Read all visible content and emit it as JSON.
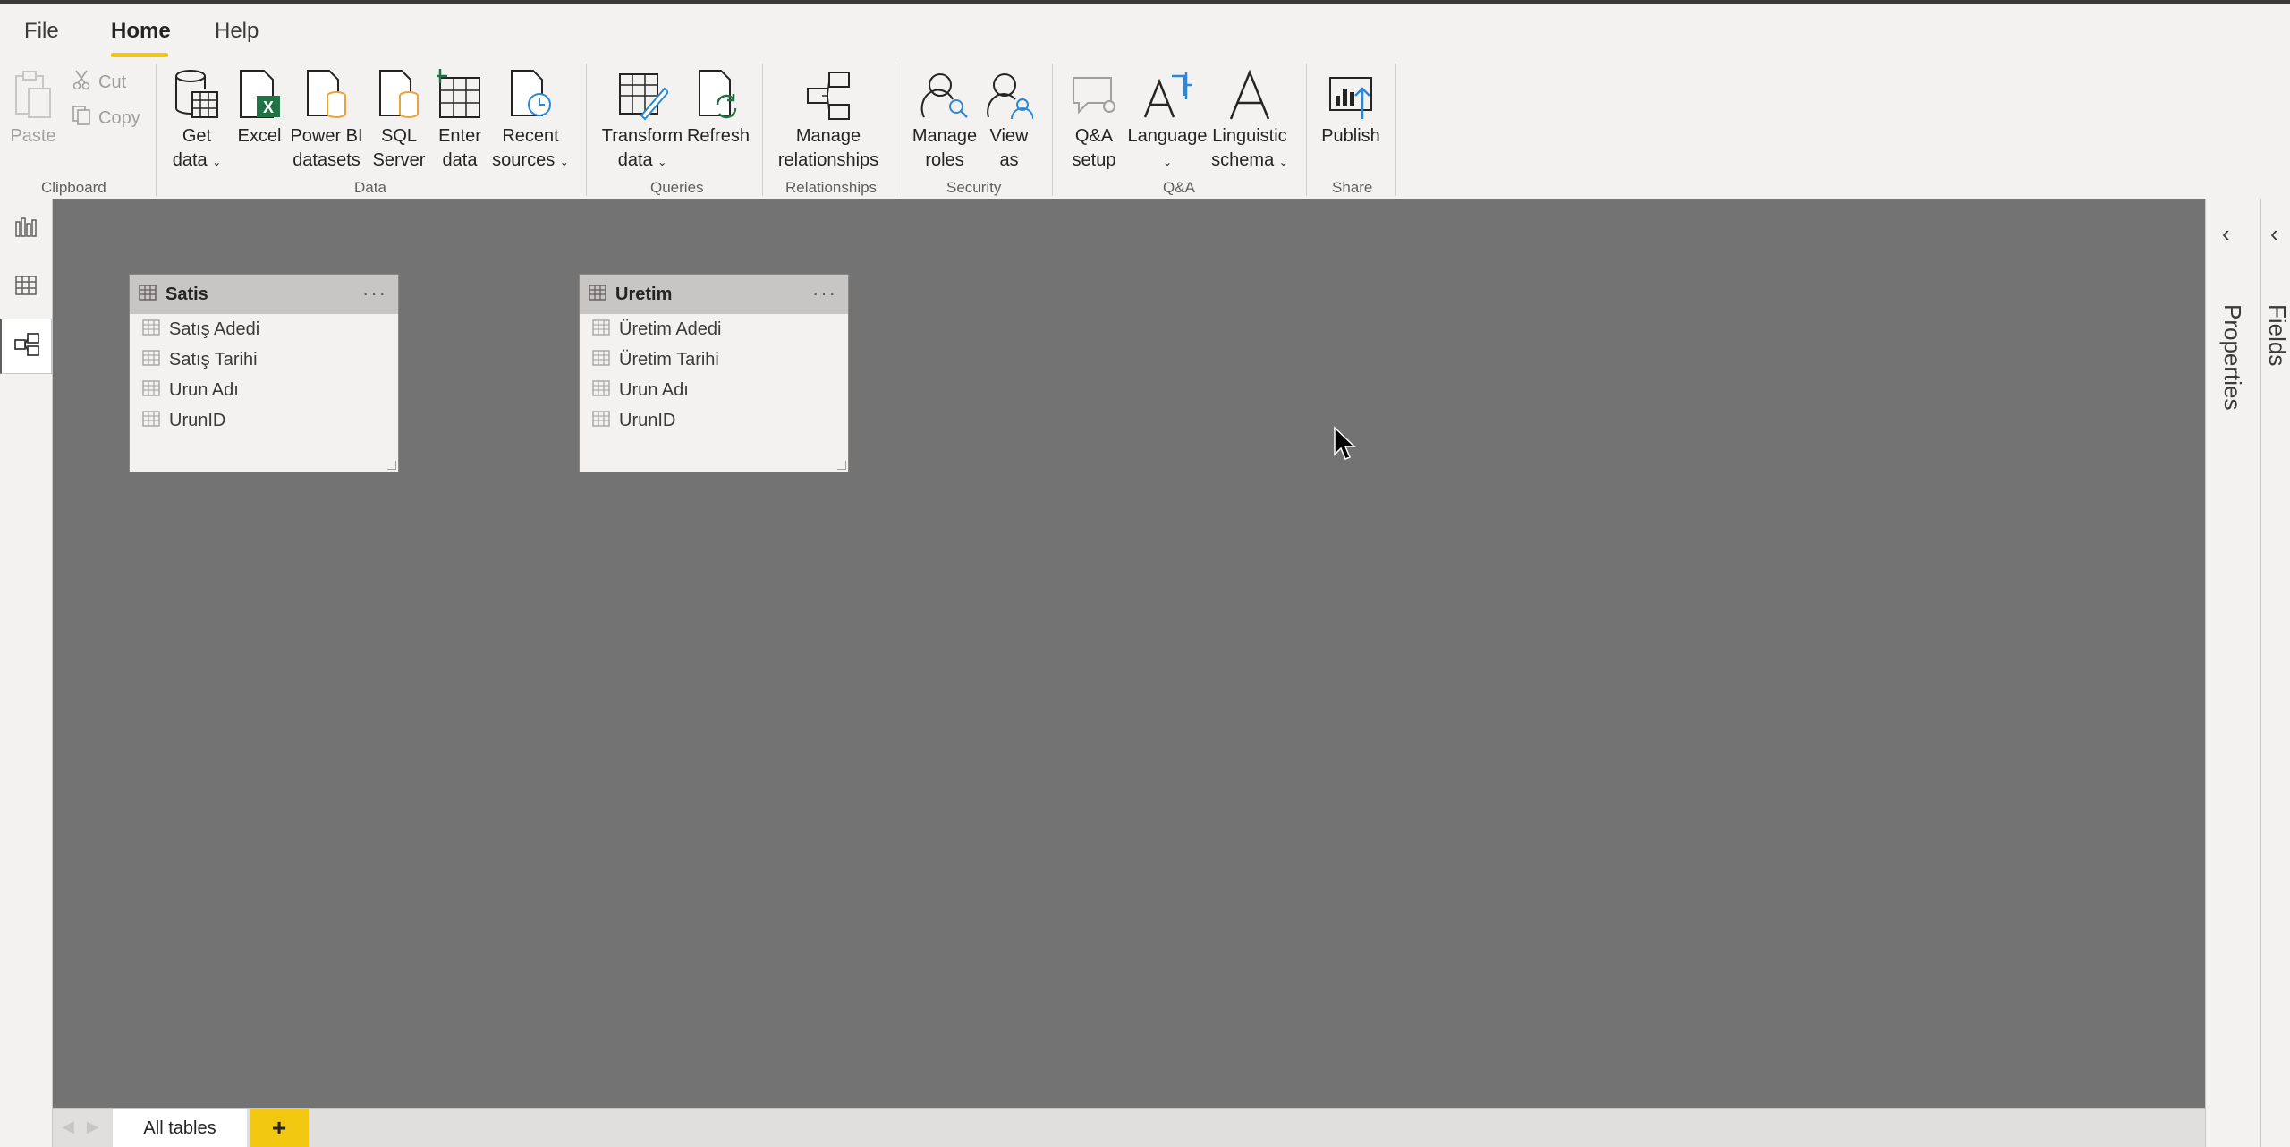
{
  "menu": {
    "tabs": [
      {
        "label": "File"
      },
      {
        "label": "Home"
      },
      {
        "label": "Help"
      }
    ],
    "active_tab": "Home"
  },
  "ribbon": {
    "clipboard": {
      "paste": "Paste",
      "cut": "Cut",
      "copy": "Copy",
      "group": "Clipboard"
    },
    "data": {
      "get_data_1": "Get",
      "get_data_2": "data",
      "excel": "Excel",
      "pbi_1": "Power BI",
      "pbi_2": "datasets",
      "sql_1": "SQL",
      "sql_2": "Server",
      "enter_1": "Enter",
      "enter_2": "data",
      "recent_1": "Recent",
      "recent_2": "sources",
      "group": "Data"
    },
    "queries": {
      "transform_1": "Transform",
      "transform_2": "data",
      "refresh": "Refresh",
      "group": "Queries"
    },
    "relationships": {
      "manage_1": "Manage",
      "manage_2": "relationships",
      "group": "Relationships"
    },
    "security": {
      "roles_1": "Manage",
      "roles_2": "roles",
      "view_1": "View",
      "view_2": "as",
      "group": "Security"
    },
    "qa": {
      "setup_1": "Q&A",
      "setup_2": "setup",
      "language": "Language",
      "ling_1": "Linguistic",
      "ling_2": "schema",
      "group": "Q&A"
    },
    "share": {
      "publish": "Publish",
      "group": "Share"
    }
  },
  "tables": [
    {
      "name": "Satis",
      "fields": [
        "Satış Adedi",
        "Satış Tarihi",
        "Urun Adı",
        "UrunID"
      ]
    },
    {
      "name": "Uretim",
      "fields": [
        "Üretim Adedi",
        "Üretim Tarihi",
        "Urun Adı",
        "UrunID"
      ]
    }
  ],
  "panes": {
    "properties": "Properties",
    "fields": "Fields"
  },
  "bottom": {
    "page_tab": "All tables",
    "add_tab": "+"
  },
  "colors": {
    "accent": "#f2c811",
    "canvas": "#737373",
    "excel_green": "#217346",
    "db_orange": "#e8a33d",
    "icon_blue": "#2b88d8"
  }
}
